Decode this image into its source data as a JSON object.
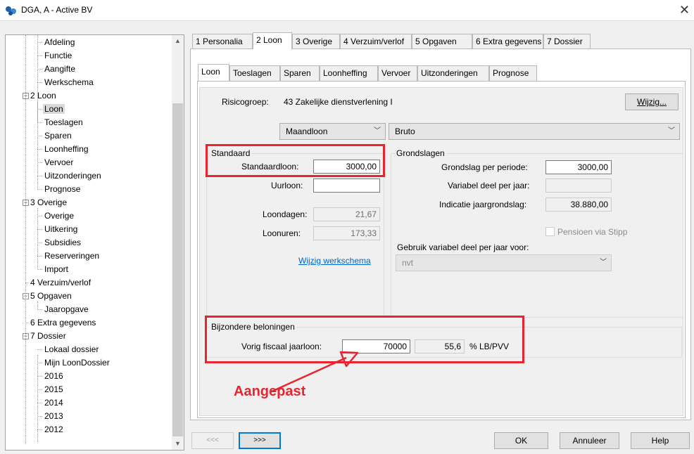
{
  "window": {
    "title": "DGA, A - Active BV",
    "close_glyph": "✕"
  },
  "tree": {
    "items": [
      {
        "label": "Afdeling"
      },
      {
        "label": "Functie"
      },
      {
        "label": "Aangifte"
      },
      {
        "label": "Werkschema"
      },
      {
        "label": "2 Loon"
      },
      {
        "label": "Loon"
      },
      {
        "label": "Toeslagen"
      },
      {
        "label": "Sparen"
      },
      {
        "label": "Loonheffing"
      },
      {
        "label": "Vervoer"
      },
      {
        "label": "Uitzonderingen"
      },
      {
        "label": "Prognose"
      },
      {
        "label": "3 Overige"
      },
      {
        "label": "Overige"
      },
      {
        "label": "Uitkering"
      },
      {
        "label": "Subsidies"
      },
      {
        "label": "Reserveringen"
      },
      {
        "label": "Import"
      },
      {
        "label": "4 Verzuim/verlof"
      },
      {
        "label": "5 Opgaven"
      },
      {
        "label": "Jaaropgave"
      },
      {
        "label": "6 Extra gegevens"
      },
      {
        "label": "7 Dossier"
      },
      {
        "label": "Lokaal dossier"
      },
      {
        "label": "Mijn LoonDossier"
      },
      {
        "label": "2016"
      },
      {
        "label": "2015"
      },
      {
        "label": "2014"
      },
      {
        "label": "2013"
      },
      {
        "label": "2012"
      }
    ],
    "selected": "Loon"
  },
  "main_tabs": [
    "1 Personalia",
    "2 Loon",
    "3 Overige",
    "4 Verzuim/verlof",
    "5 Opgaven",
    "6 Extra gegevens",
    "7 Dossier"
  ],
  "sub_tabs": [
    "Loon",
    "Toeslagen",
    "Sparen",
    "Loonheffing",
    "Vervoer",
    "Uitzonderingen",
    "Prognose"
  ],
  "risk": {
    "label": "Risicogroep:",
    "value": "43 Zakelijke dienstverlening I",
    "button": "Wijzig..."
  },
  "combos": {
    "period": "Maandloon",
    "type": "Bruto"
  },
  "standaard": {
    "title": "Standaard",
    "standaardloon_label": "Standaardloon:",
    "standaardloon_value": "3000,00",
    "uurloon_label": "Uurloon:",
    "uurloon_value": "",
    "loondagen_label": "Loondagen:",
    "loondagen_value": "21,67",
    "loonuren_label": "Loonuren:",
    "loonuren_value": "173,33",
    "link": "Wijzig werkschema"
  },
  "grondslagen": {
    "title": "Grondslagen",
    "per_periode_label": "Grondslag per periode:",
    "per_periode_value": "3000,00",
    "variabel_label": "Variabel deel per jaar:",
    "variabel_value": "",
    "indicatie_label": "Indicatie jaargrondslag:",
    "indicatie_value": "38.880,00",
    "pensioen_label": "Pensioen via Stipp",
    "gebruik_label": "Gebruik variabel deel per jaar voor:",
    "gebruik_value": "nvt"
  },
  "bijzondere": {
    "title": "Bijzondere beloningen",
    "label": "Vorig fiscaal jaarloon:",
    "value": "70000",
    "percent_value": "55,6",
    "percent_label": "% LB/PVV"
  },
  "annotation": {
    "text": "Aangepast",
    "color": "#e8242e"
  },
  "footer": {
    "prev": "<<<",
    "next": ">>>",
    "ok": "OK",
    "cancel": "Annuleer",
    "help": "Help"
  },
  "colors": {
    "accent_red": "#e8242e",
    "link_blue": "#0066cc",
    "selected_bg": "#d9d9d9"
  }
}
